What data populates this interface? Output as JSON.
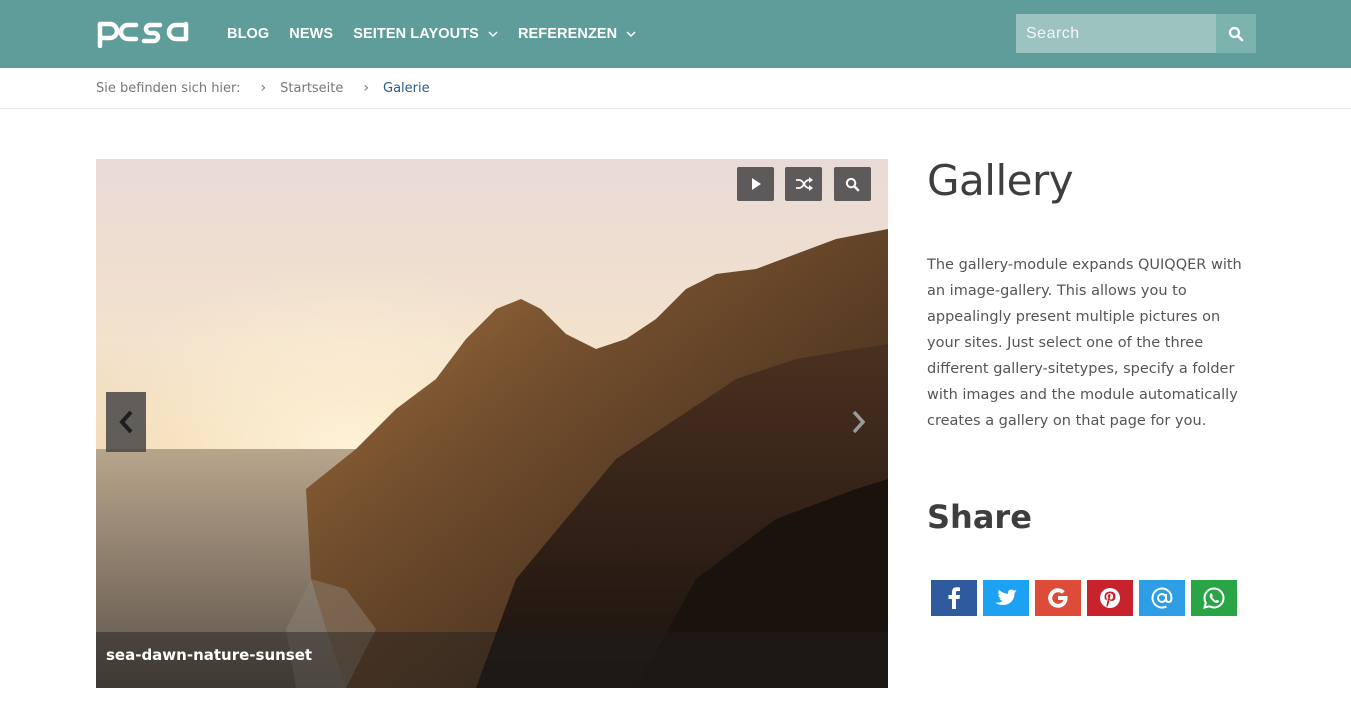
{
  "header": {
    "logo_text": "pcsg",
    "nav": [
      {
        "label": "BLOG",
        "dropdown": false
      },
      {
        "label": "NEWS",
        "dropdown": false
      },
      {
        "label": "SEITEN LAYOUTS",
        "dropdown": true
      },
      {
        "label": "REFERENZEN",
        "dropdown": true
      }
    ],
    "search": {
      "placeholder": "Search",
      "value": ""
    },
    "colors": {
      "bar": "#5e9d99",
      "search_field": "#9dc3c0"
    }
  },
  "breadcrumb": {
    "prefix": "Sie befinden sich hier:",
    "items": [
      "Startseite",
      "Galerie"
    ],
    "active_color": "#2d5b86"
  },
  "gallery": {
    "controls": [
      "play-icon",
      "shuffle-icon",
      "zoom-icon"
    ],
    "caption": "sea-dawn-nature-sunset"
  },
  "content": {
    "title": "Gallery",
    "description": "The gallery-module expands QUIQQER with an image-gallery. This allows you to appealingly present multiple pictures on your sites. Just select one of the three different gallery-sitetypes, specify a folder with images and the module automatically creates a gallery on that page for you."
  },
  "share": {
    "title": "Share",
    "buttons": [
      {
        "name": "facebook",
        "icon": "facebook-icon",
        "color": "#2f5a9e"
      },
      {
        "name": "twitter",
        "icon": "twitter-icon",
        "color": "#1da1f2"
      },
      {
        "name": "google",
        "icon": "google-icon",
        "color": "#dd4b39"
      },
      {
        "name": "pinterest",
        "icon": "pinterest-icon",
        "color": "#c8232c"
      },
      {
        "name": "email",
        "icon": "at-icon",
        "color": "#2d9de6"
      },
      {
        "name": "whatsapp",
        "icon": "whatsapp-icon",
        "color": "#2aa546"
      }
    ]
  }
}
